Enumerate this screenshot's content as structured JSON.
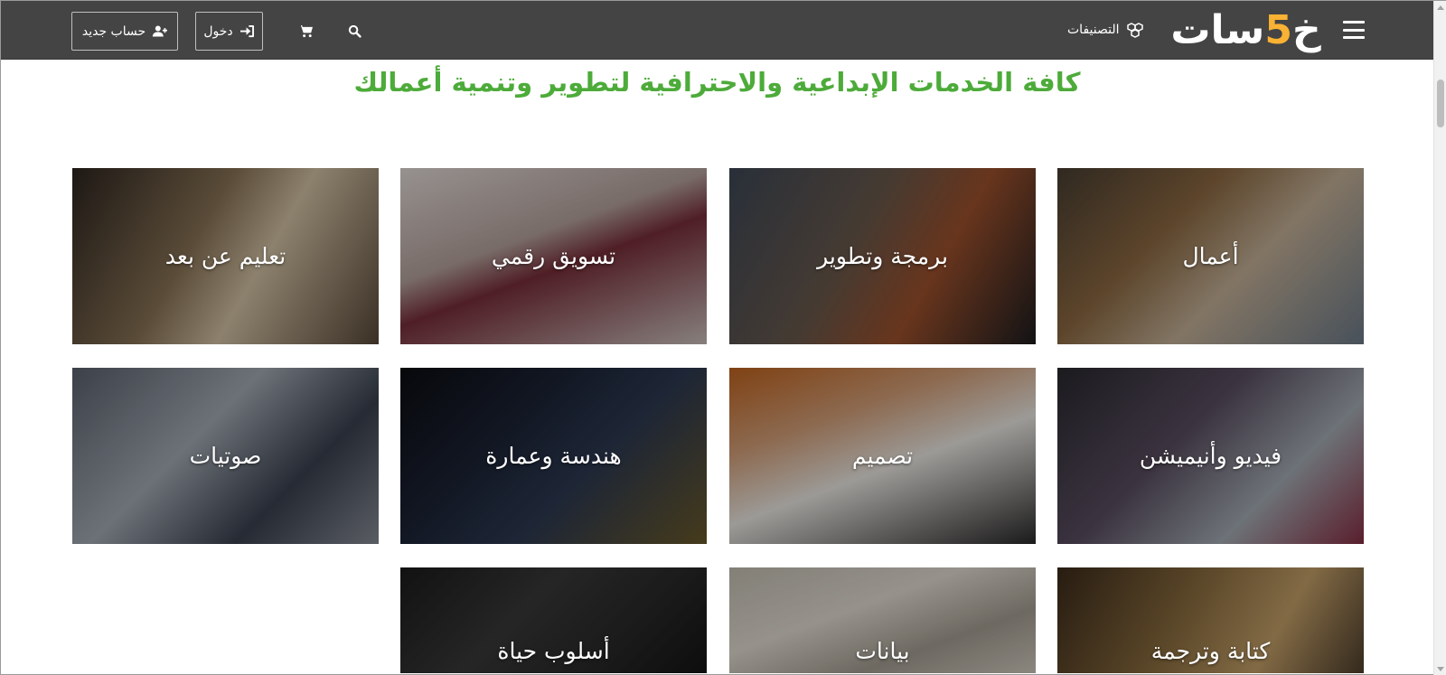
{
  "header": {
    "logo_parts": [
      "خ",
      "5",
      "سات"
    ],
    "categories_label": "التصنيفات",
    "login_label": "دخول",
    "register_label": "حساب جديد",
    "background": "#444444",
    "accent": "#f9b233"
  },
  "main": {
    "heading": "كافة الخدمات الإبداعية والاحترافية لتطوير وتنمية أعمالك",
    "heading_color": "#4dab3a",
    "categories": [
      {
        "label": "أعمال",
        "image": "business"
      },
      {
        "label": "برمجة وتطوير",
        "image": "programming"
      },
      {
        "label": "تسويق رقمي",
        "image": "marketing"
      },
      {
        "label": "تعليم عن بعد",
        "image": "education"
      },
      {
        "label": "فيديو وأنيميشن",
        "image": "video-animation"
      },
      {
        "label": "تصميم",
        "image": "design"
      },
      {
        "label": "هندسة وعمارة",
        "image": "engineering-architecture"
      },
      {
        "label": "صوتيات",
        "image": "audio"
      },
      {
        "label": "كتابة وترجمة",
        "image": "writing-translation"
      },
      {
        "label": "بيانات",
        "image": "data"
      },
      {
        "label": "أسلوب حياة",
        "image": "lifestyle"
      }
    ]
  },
  "icons": {
    "menu": "hamburger-menu-icon",
    "categories": "cubes-icon",
    "search": "search-icon",
    "cart": "cart-icon",
    "login": "sign-in-icon",
    "register": "user-plus-icon"
  }
}
